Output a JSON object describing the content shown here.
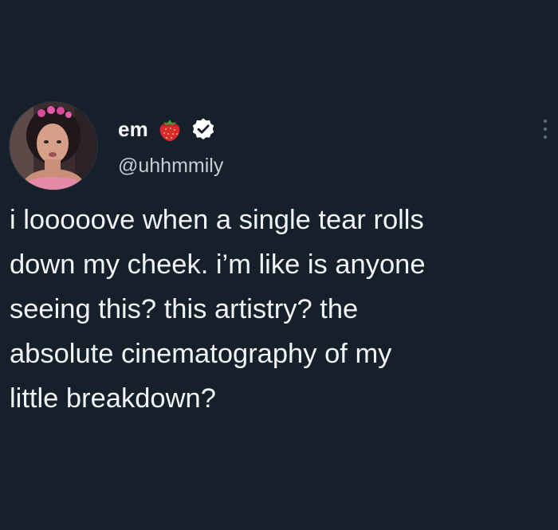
{
  "tweet": {
    "author": {
      "display_name": "em",
      "handle": "@uhhmmily",
      "name_emoji": "strawberry-icon",
      "verified": true
    },
    "text": "i looooove when a single tear rolls\ndown my cheek. i’m like is anyone\nseeing this? this artistry? the\nabsolute cinematography of my\nlittle breakdown?"
  },
  "colors": {
    "background": "#16202b",
    "text": "#f1f3f5",
    "handle": "#c5ccd3"
  }
}
